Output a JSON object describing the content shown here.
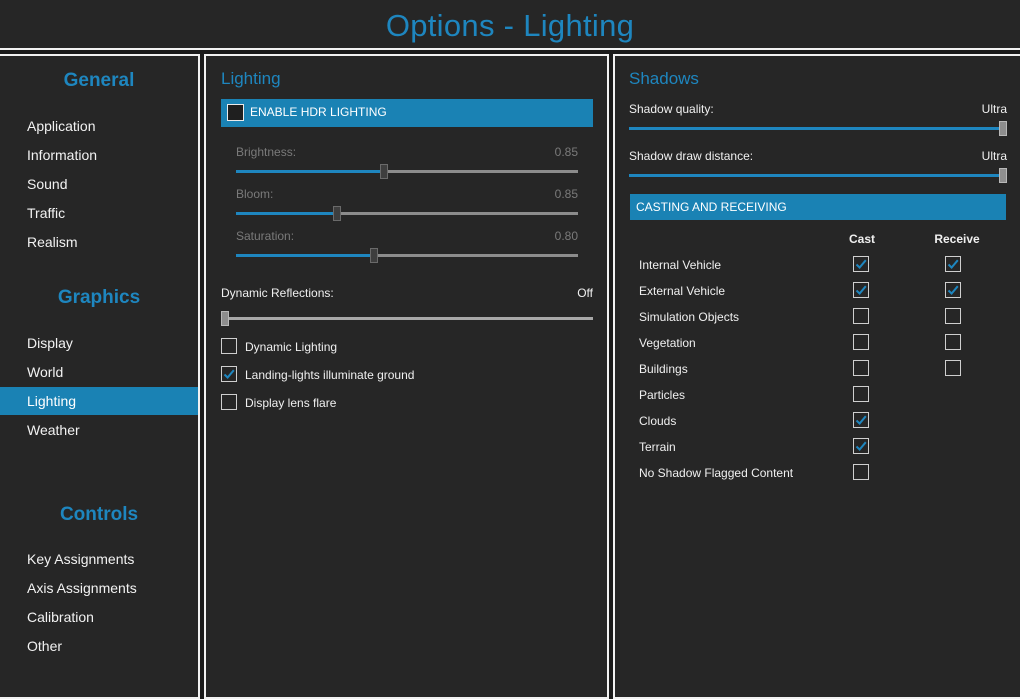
{
  "window": {
    "title": "Options - Lighting"
  },
  "nav": {
    "sections": [
      {
        "heading": "General",
        "items": [
          "Application",
          "Information",
          "Sound",
          "Traffic",
          "Realism"
        ]
      },
      {
        "heading": "Graphics",
        "items": [
          "Display",
          "World",
          "Lighting",
          "Weather"
        ]
      },
      {
        "heading": "Controls",
        "items": [
          "Key Assignments",
          "Axis Assignments",
          "Calibration",
          "Other"
        ]
      }
    ],
    "active_item": "Lighting"
  },
  "lighting": {
    "title": "Lighting",
    "hdr": {
      "label": "ENABLE HDR LIGHTING",
      "checked": false
    },
    "sliders": [
      {
        "label": "Brightness:",
        "value": "0.85",
        "level": 0.43
      },
      {
        "label": "Bloom:",
        "value": "0.85",
        "level": 0.29
      },
      {
        "label": "Saturation:",
        "value": "0.80",
        "level": 0.4
      }
    ],
    "reflections": {
      "label": "Dynamic Reflections:",
      "value": "Off",
      "level": 0.0
    },
    "checkboxes": [
      {
        "label": "Dynamic Lighting",
        "checked": false
      },
      {
        "label": "Landing-lights illuminate ground",
        "checked": true
      },
      {
        "label": "Display lens flare",
        "checked": false
      }
    ]
  },
  "shadows": {
    "title": "Shadows",
    "quality": {
      "label": "Shadow quality:",
      "value": "Ultra",
      "level": 1.0
    },
    "distance": {
      "label": "Shadow draw distance:",
      "value": "Ultra",
      "level": 1.0
    },
    "casting_header": "CASTING AND RECEIVING",
    "columns": {
      "cast": "Cast",
      "receive": "Receive"
    },
    "rows": [
      {
        "label": "Internal Vehicle",
        "cast": true,
        "receive": true
      },
      {
        "label": "External Vehicle",
        "cast": true,
        "receive": true
      },
      {
        "label": "Simulation Objects",
        "cast": false,
        "receive": false
      },
      {
        "label": "Vegetation",
        "cast": false,
        "receive": false
      },
      {
        "label": "Buildings",
        "cast": false,
        "receive": false
      },
      {
        "label": "Particles",
        "cast": false,
        "receive": null
      },
      {
        "label": "Clouds",
        "cast": true,
        "receive": null
      },
      {
        "label": "Terrain",
        "cast": true,
        "receive": null
      },
      {
        "label": "No Shadow Flagged Content",
        "cast": false,
        "receive": null
      }
    ]
  },
  "colors": {
    "accent": "#1e86bf",
    "highlight": "#1a82b4",
    "panel": "#262626",
    "background": "#1b1b1b"
  },
  "icons": {
    "check": "check-icon"
  }
}
